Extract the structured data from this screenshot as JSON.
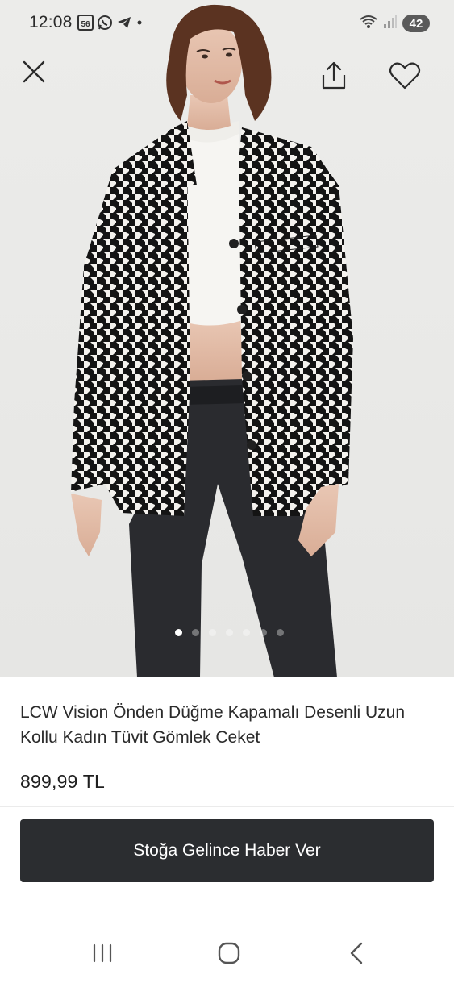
{
  "status_bar": {
    "time": "12:08",
    "battery": "42",
    "left_icons": [
      "gallery-56-icon",
      "whatsapp-icon",
      "telegram-icon",
      "dot-icon"
    ],
    "right_icons": [
      "wifi-icon",
      "signal-icon"
    ]
  },
  "actions": {
    "close_icon": "close-icon",
    "share_icon": "share-icon",
    "favorite_icon": "heart-icon"
  },
  "carousel": {
    "count": 7,
    "active_index": 0
  },
  "product": {
    "title": "LCW Vision Önden Düğme Kapamalı Desenli Uzun Kollu Kadın Tüvit Gömlek Ceket",
    "price": "899,99 TL"
  },
  "cta": {
    "label": "Stoğa Gelince Haber Ver",
    "color": "#2b2d30"
  },
  "navbar": {
    "icons": [
      "recents-icon",
      "home-icon",
      "back-icon"
    ]
  }
}
